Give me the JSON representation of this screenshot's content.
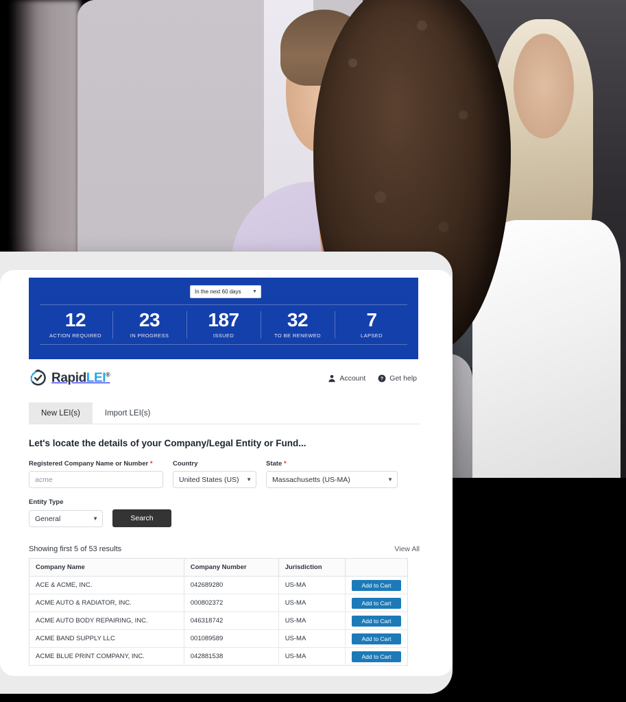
{
  "stats_banner": {
    "period_selected": "In the next 60 days",
    "period_options": [
      "In the next 60 days"
    ],
    "accent_color": "#1440ac",
    "items": [
      {
        "value": "12",
        "label": "ACTION REQUIRED"
      },
      {
        "value": "23",
        "label": "IN PROGRESS"
      },
      {
        "value": "187",
        "label": "ISSUED"
      },
      {
        "value": "32",
        "label": "TO BE RENEWED"
      },
      {
        "value": "7",
        "label": "LAPSED"
      }
    ]
  },
  "brand": {
    "name_part1": "Rapid",
    "name_part2": "LEI",
    "trademark": "®",
    "mark_icon": "stopwatch-check-icon",
    "color_dark": "#2b3440",
    "color_blue": "#2aa3e8"
  },
  "header_links": [
    {
      "label": "Account",
      "icon": "user-icon"
    },
    {
      "label": "Get help",
      "icon": "question-circle-icon"
    }
  ],
  "tabs": [
    {
      "label": "New LEI(s)",
      "active": true
    },
    {
      "label": "Import LEI(s)",
      "active": false
    }
  ],
  "form": {
    "heading": "Let's locate the details of your Company/Legal Entity or Fund...",
    "company": {
      "label": "Registered Company Name or Number",
      "required_marker": "*",
      "value": "",
      "placeholder": "acme"
    },
    "country": {
      "label": "Country",
      "required_marker": "",
      "value": "United States (US)",
      "options": [
        "United States (US)"
      ]
    },
    "state": {
      "label": "State",
      "required_marker": "*",
      "value": "Massachusetts (US-MA)",
      "options": [
        "Massachusetts (US-MA)"
      ]
    },
    "entity_type": {
      "label": "Entity Type",
      "required_marker": "",
      "value": "General",
      "options": [
        "General"
      ]
    },
    "search_button": "Search"
  },
  "results": {
    "count_text": "Showing first 5 of 53 results",
    "view_all": "View All",
    "columns": [
      "Company Name",
      "Company Number",
      "Jurisdiction",
      ""
    ],
    "action_label": "Add to Cart",
    "action_color": "#1c7ab8",
    "rows": [
      {
        "name": "ACE & ACME, INC.",
        "number": "042689280",
        "jurisdiction": "US-MA"
      },
      {
        "name": "ACME AUTO & RADIATOR, INC.",
        "number": "000802372",
        "jurisdiction": "US-MA"
      },
      {
        "name": "ACME AUTO BODY REPAIRING, INC.",
        "number": "046318742",
        "jurisdiction": "US-MA"
      },
      {
        "name": "ACME BAND SUPPLY LLC",
        "number": "001089589",
        "jurisdiction": "US-MA"
      },
      {
        "name": "ACME BLUE PRINT COMPANY, INC.",
        "number": "042881538",
        "jurisdiction": "US-MA"
      }
    ]
  },
  "hero": {
    "alt": "Three women working together at an office desk with laptops"
  }
}
